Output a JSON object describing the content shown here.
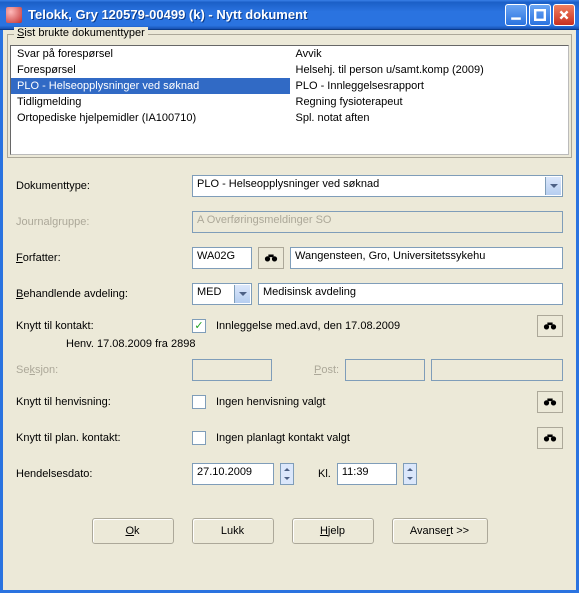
{
  "window": {
    "title": "Telokk, Gry  120579-00499 (k) - Nytt dokument"
  },
  "group": {
    "label_pre": "S",
    "label_rest": "ist brukte dokumenttyper"
  },
  "recent": {
    "left": [
      "Svar på forespørsel",
      "Forespørsel",
      "PLO - Helseopplysninger ved søknad",
      "Tidligmelding",
      "Ortopediske hjelpemidler (IA100710)"
    ],
    "right": [
      "Avvik",
      "Helsehj. til person u/samt.komp (2009)",
      "PLO - Innleggelsesrapport",
      "Regning fysioterapeut",
      "Spl. notat aften"
    ],
    "selected_index": 2
  },
  "labels": {
    "doc_type": "Dokumenttype:",
    "journal_group": "Journalgruppe:",
    "author": "Forfatter:",
    "department": "Behandlende avdeling:",
    "contact": "Knytt til kontakt:",
    "seksjon": "Seksjon:",
    "post": "Post:",
    "henvisning": "Knytt til henvisning:",
    "plan_kontakt": "Knytt til plan. kontakt:",
    "hendelsesdato": "Hendelsesdato:",
    "kl": "Kl.",
    "ok": "Ok",
    "lukk": "Lukk",
    "hjelp": "Hjelp",
    "avansert": "Avansert >>"
  },
  "values": {
    "doc_type": "PLO - Helseopplysninger ved søknad",
    "journal_group": "A Overføringsmeldinger SO",
    "author_code": "WA02G",
    "author_name": "Wangensteen, Gro, Universitetssykehu",
    "dept_code": "MED",
    "dept_name": "Medisinsk avdeling",
    "contact_checked": true,
    "contact_text": "Innleggelse med.avd, den 17.08.2009",
    "henv_text": "Henv. 17.08.2009 fra 2898",
    "henvisning_checked": false,
    "henvisning_text": "Ingen henvisning valgt",
    "plan_checked": false,
    "plan_text": "Ingen planlagt kontakt valgt",
    "date": "27.10.2009",
    "time": "11:39"
  }
}
